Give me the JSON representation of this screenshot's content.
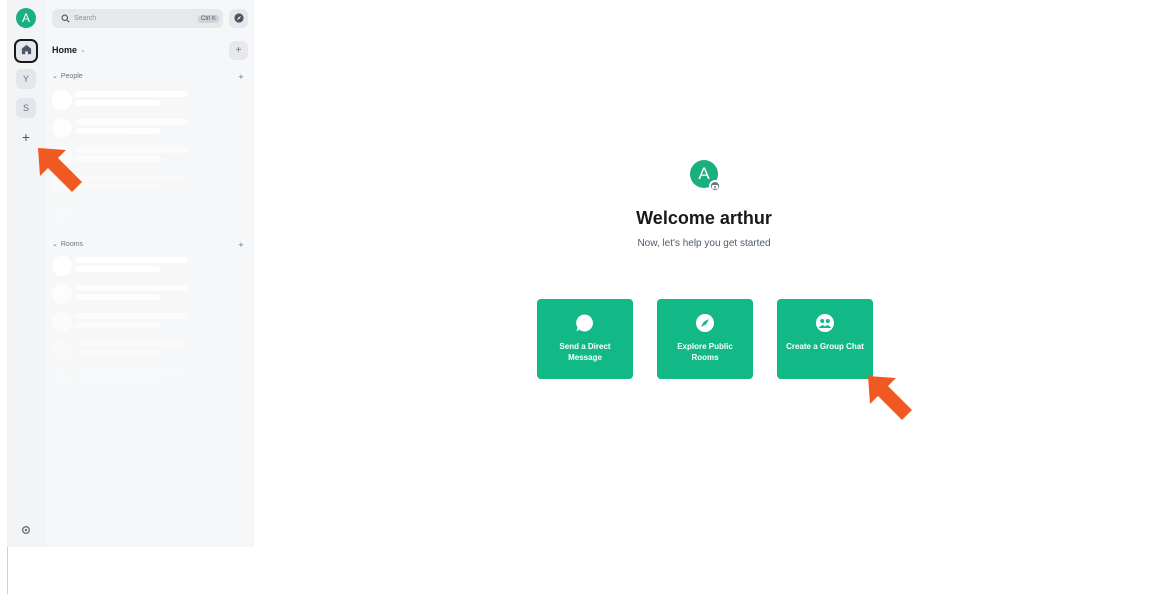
{
  "spacebar": {
    "user_initial": "A",
    "spaces": [
      {
        "initial": "Y"
      },
      {
        "initial": "S"
      }
    ],
    "add_symbol": "+"
  },
  "roomlist": {
    "search_placeholder": "Search",
    "search_shortcut": "Ctrl K",
    "title": "Home",
    "add_symbol": "+",
    "sections": [
      {
        "label": "People",
        "add_symbol": "+"
      },
      {
        "label": "Rooms",
        "add_symbol": "+"
      }
    ]
  },
  "welcome": {
    "avatar_initial": "A",
    "title": "Welcome arthur",
    "subtitle": "Now, let's help you get started",
    "actions": [
      {
        "label": "Send a Direct Message",
        "icon": "chat-bubble-icon"
      },
      {
        "label": "Explore Public Rooms",
        "icon": "compass-icon"
      },
      {
        "label": "Create a Group Chat",
        "icon": "group-icon"
      }
    ]
  },
  "colors": {
    "accent": "#12b886",
    "annotation_arrow": "#f05a22"
  }
}
